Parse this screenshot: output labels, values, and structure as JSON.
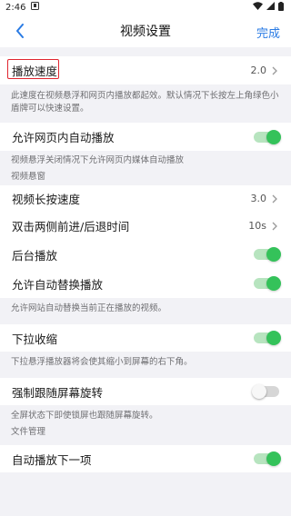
{
  "statusbar": {
    "time": "2:46"
  },
  "navbar": {
    "title": "视频设置",
    "done": "完成"
  },
  "settings": {
    "speed_label": "播放速度",
    "speed_value": "2.0",
    "speed_note": "此速度在视频悬浮和网页内播放都起效。默认情况下长按左上角绿色小盾牌可以快速设置。",
    "autoplay_label": "允许网页内自动播放",
    "autoplay_note": "视频悬浮关闭情况下允许网页内媒体自动播放",
    "video_float_header": "视频悬窗",
    "long_press_label": "视频长按速度",
    "long_press_value": "3.0",
    "double_tap_label": "双击两侧前进/后退时间",
    "double_tap_value": "10s",
    "background_label": "后台播放",
    "auto_replace_label": "允许自动替换播放",
    "auto_replace_note": "允许网站自动替换当前正在播放的视频。",
    "pull_shrink_label": "下拉收缩",
    "pull_shrink_note": "下拉悬浮播放器将会使其缩小到屏幕的右下角。",
    "force_rotate_label": "强制跟随屏幕旋转",
    "force_rotate_note": "全屏状态下即使锁屏也跟随屏幕旋转。",
    "file_mgmt_header": "文件管理",
    "auto_next_label": "自动播放下一项"
  },
  "toggles": {
    "autoplay": true,
    "background": true,
    "auto_replace": true,
    "pull_shrink": true,
    "force_rotate": false,
    "auto_next": true
  },
  "colors": {
    "accent": "#2a7be4",
    "toggle_on": "#34c25a",
    "highlight": "#e0252f"
  }
}
